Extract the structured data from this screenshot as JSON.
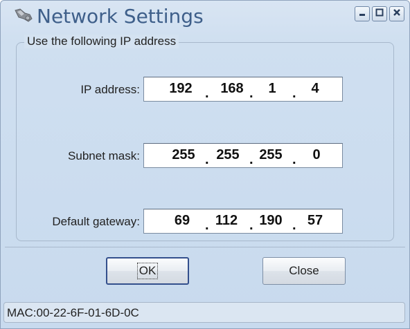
{
  "window": {
    "title": "Network Settings",
    "icon": "network-tool-icon",
    "controls": {
      "minimize": "minimize-icon",
      "maximize": "maximize-icon",
      "close": "close-icon"
    }
  },
  "group": {
    "label": "Use the following IP address",
    "fields": [
      {
        "label": "IP address:",
        "octets": [
          "192",
          "168",
          "1",
          "4"
        ]
      },
      {
        "label": "Subnet mask:",
        "octets": [
          "255",
          "255",
          "255",
          "0"
        ]
      },
      {
        "label": "Default gateway:",
        "octets": [
          "69",
          "112",
          "190",
          "57"
        ]
      }
    ]
  },
  "buttons": {
    "ok": "OK",
    "close": "Close"
  },
  "status": {
    "mac": "MAC:00-22-6F-01-6D-0C"
  }
}
